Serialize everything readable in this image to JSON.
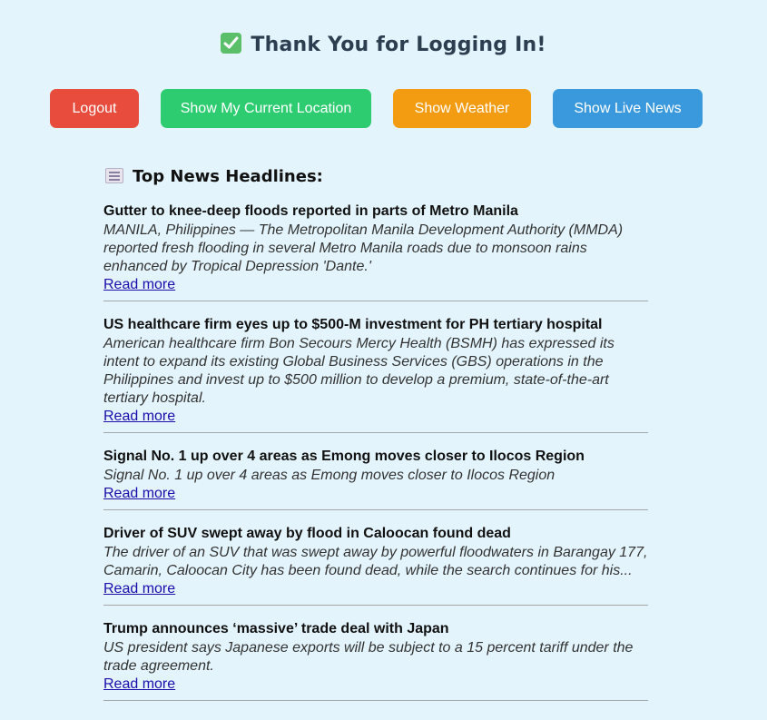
{
  "header": {
    "title": "Thank You for Logging In!",
    "icon": "check-mark-button-icon"
  },
  "buttons": {
    "logout": "Logout",
    "location": "Show My Current Location",
    "weather": "Show Weather",
    "news": "Show Live News"
  },
  "colors": {
    "logout": "#e74c3c",
    "location": "#2ecc71",
    "weather": "#f39c12",
    "news": "#3a99dc",
    "background": "#e3f4fc"
  },
  "news": {
    "heading": "Top News Headlines:",
    "icon": "newspaper-icon",
    "articles": [
      {
        "title": "Gutter to knee-deep floods reported in parts of Metro Manila",
        "description": "MANILA, Philippines — The Metropolitan Manila Development Authority (MMDA) reported fresh flooding in several Metro Manila roads due to monsoon rains enhanced by Tropical Depression 'Dante.'",
        "link_text": "Read more"
      },
      {
        "title": "US healthcare firm eyes up to $500-M investment for PH tertiary hospital",
        "description": "American healthcare firm Bon Secours Mercy Health (BSMH) has expressed its intent to expand its existing Global Business Services (GBS) operations in the Philippines and invest up to $500 million to develop a premium, state-of-the-art tertiary hospital.",
        "link_text": "Read more"
      },
      {
        "title": "Signal No. 1 up over 4 areas as Emong moves closer to Ilocos Region",
        "description": "Signal No. 1 up over 4 areas as Emong moves closer to Ilocos Region",
        "link_text": "Read more"
      },
      {
        "title": "Driver of SUV swept away by flood in Caloocan found dead",
        "description": "The driver of an SUV that was swept away by powerful floodwaters in Barangay 177, Camarin, Caloocan City has been found dead, while the search continues for his...",
        "link_text": "Read more"
      },
      {
        "title": "Trump announces ‘massive’ trade deal with Japan",
        "description": "US president says Japanese exports will be subject to a 15 percent tariff under the trade agreement.",
        "link_text": "Read more"
      }
    ]
  }
}
